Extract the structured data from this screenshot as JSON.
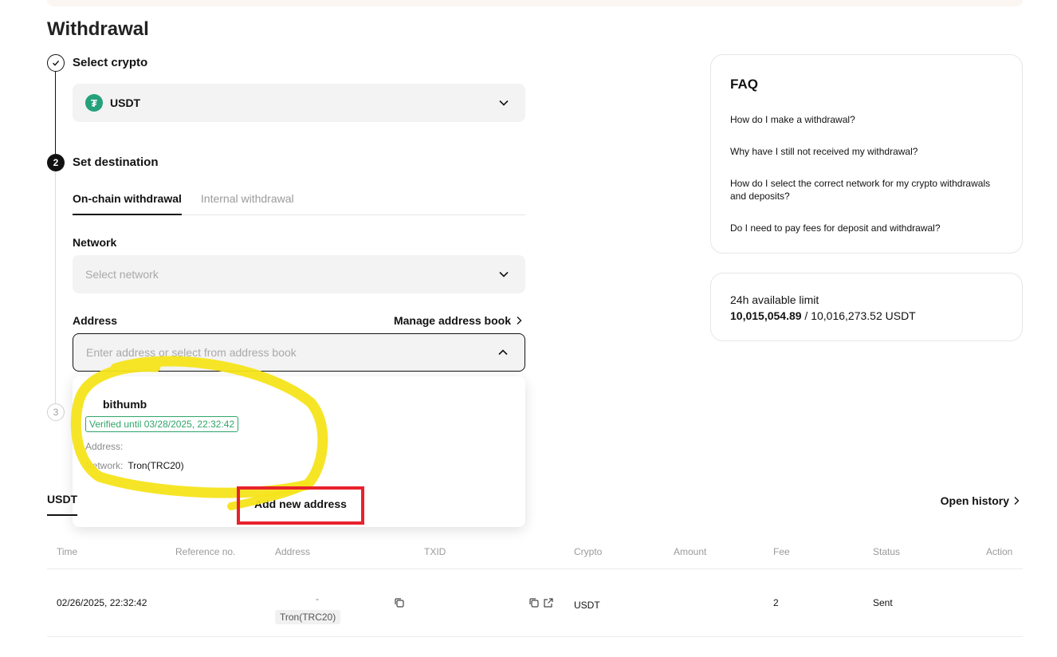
{
  "page": {
    "title": "Withdrawal"
  },
  "steps": [
    {
      "number": "",
      "title": "Select crypto"
    },
    {
      "number": "2",
      "title": "Set destination"
    },
    {
      "number": "3",
      "title": ""
    }
  ],
  "crypto_select": {
    "icon": "tether-icon",
    "value": "USDT",
    "brand_color": "#26a17b"
  },
  "destination": {
    "tabs": [
      {
        "label": "On-chain withdrawal",
        "active": true
      },
      {
        "label": "Internal withdrawal",
        "active": false
      }
    ],
    "network_label": "Network",
    "network_placeholder": "Select network",
    "address_label": "Address",
    "manage_address_book": "Manage address book",
    "address_placeholder": "Enter address or select from address book"
  },
  "address_dropdown": {
    "entries": [
      {
        "name": "bithumb",
        "verified": "Verified until 03/28/2025, 22:32:42",
        "address_label": "Address:",
        "address_value": "",
        "network_label": "Network:",
        "network_value": "Tron(TRC20)"
      }
    ],
    "add_new": "Add new address"
  },
  "faq": {
    "title": "FAQ",
    "questions": [
      "How do I make a withdrawal?",
      "Why have I still not received my withdrawal?",
      "How do I select the correct network for my crypto withdrawals and deposits?",
      "Do I need to pay fees for deposit and withdrawal?"
    ]
  },
  "limit": {
    "label": "24h available limit",
    "available": "10,015,054.89",
    "separator": " / ",
    "total": "10,016,273.52 USDT"
  },
  "history": {
    "tab": "USDT",
    "open_history": "Open history",
    "columns": [
      "Time",
      "Reference no.",
      "Address",
      "TXID",
      "Crypto",
      "Amount",
      "Fee",
      "Status",
      "Action"
    ],
    "rows": [
      {
        "time": "02/26/2025, 22:32:42",
        "reference": "",
        "address_mark": "-",
        "network": "Tron(TRC20)",
        "txid": "",
        "crypto": "USDT",
        "amount": "",
        "fee": "2",
        "status": "Sent",
        "action": ""
      }
    ]
  },
  "colors": {
    "verified_green": "#2fa56a",
    "annotation_yellow": "#f5e41a",
    "annotation_red": "#e8222c"
  }
}
